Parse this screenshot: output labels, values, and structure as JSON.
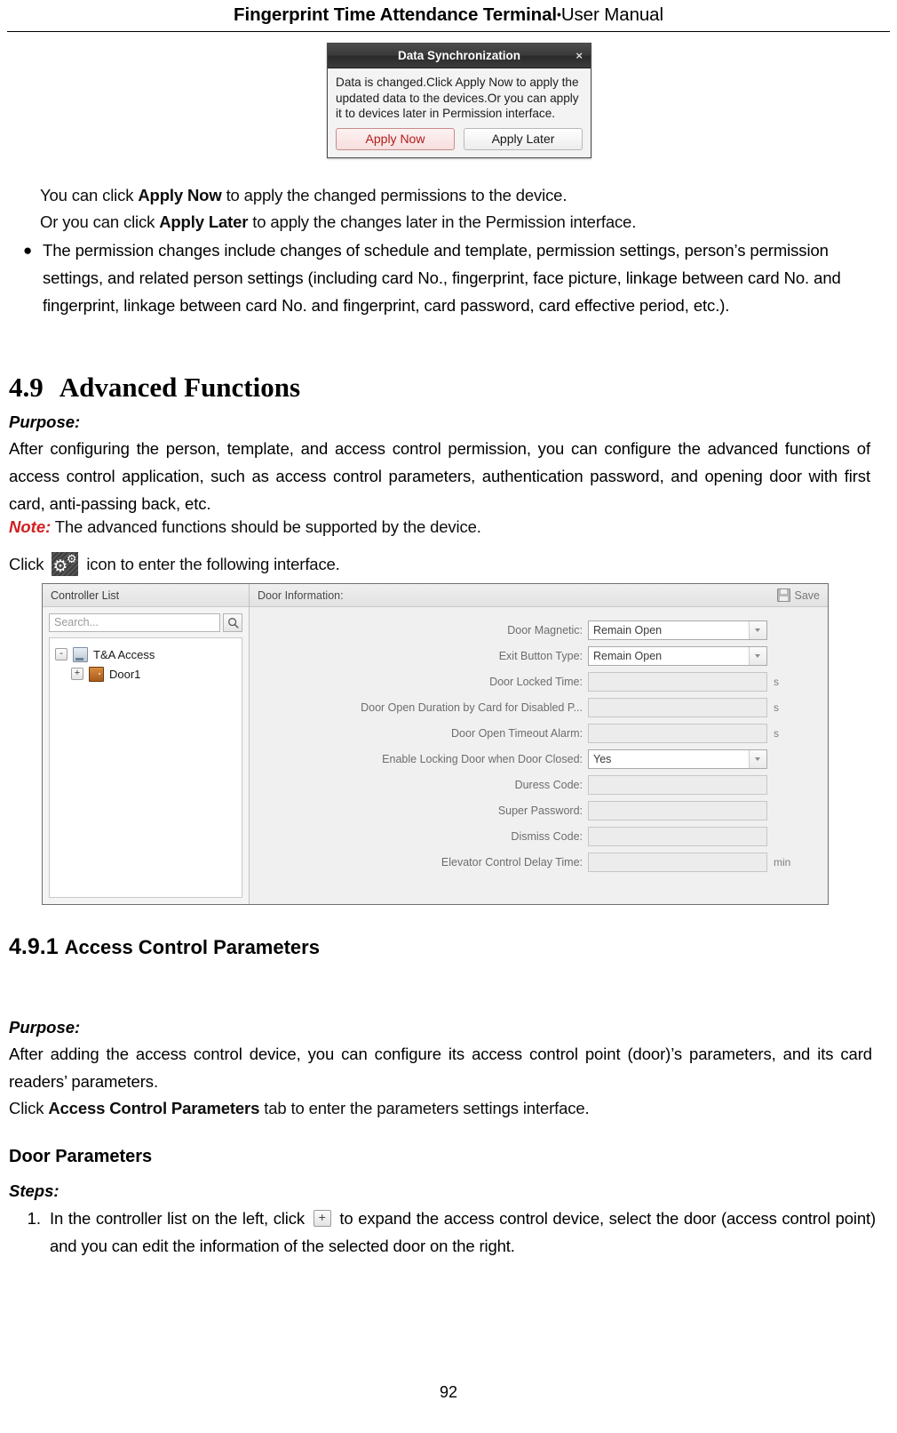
{
  "header": {
    "title_bold": "Fingerprint Time Attendance Terminal",
    "separator": "•",
    "title_normal": "User Manual"
  },
  "dialog": {
    "title": "Data Synchronization",
    "close_label": "×",
    "message": "Data is changed.Click Apply Now to apply the updated data to the devices.Or you can apply it to devices later in Permission interface.",
    "apply_now_label": "Apply Now",
    "apply_later_label": "Apply Later",
    "accent_color": "#b11b1b"
  },
  "body": {
    "line1_pre": "You can click ",
    "line1_bold": "Apply Now",
    "line1_post": " to apply the changed permissions to the device.",
    "line2_pre": "Or you can click ",
    "line2_bold": "Apply Later",
    "line2_post": " to apply the changes later in the Permission interface.",
    "bullet_symbol": "●",
    "bullet_text": "The permission changes include changes of schedule and template, permission settings, person’s permission settings, and related person settings (including card No., fingerprint, face picture, linkage between card No. and fingerprint, linkage between card No. and fingerprint, card password, card effective period, etc.)."
  },
  "section_49": {
    "number": "4.9",
    "title": "Advanced Functions",
    "purpose_label": "Purpose:",
    "purpose_text": "After configuring the person, template, and access control permission, you can configure the advanced functions of access control application, such as access control parameters, authentication password, and opening door with first card, anti-passing back, etc.",
    "note_label": "Note:",
    "note_text": "The advanced functions should be supported by the device.",
    "click_pre": "Click",
    "click_post": "icon to enter the following interface.",
    "note_color": "#d21f1f"
  },
  "app": {
    "left_panel": {
      "header": "Controller List",
      "search_placeholder": "Search...",
      "search_icon": "search-icon",
      "tree": [
        {
          "label": "T&A Access",
          "expander": "-",
          "icon": "device-icon",
          "level": 0
        },
        {
          "label": "Door1",
          "expander": "+",
          "icon": "door-icon",
          "level": 1
        }
      ]
    },
    "right_panel": {
      "header": "Door Information:",
      "save_label": "Save",
      "save_icon": "save-icon",
      "fields": [
        {
          "label": "Door Magnetic:",
          "type": "select",
          "value": "Remain Open",
          "unit": ""
        },
        {
          "label": "Exit Button Type:",
          "type": "select",
          "value": "Remain Open",
          "unit": ""
        },
        {
          "label": "Door Locked Time:",
          "type": "input",
          "value": "",
          "unit": "s"
        },
        {
          "label": "Door Open Duration by Card for Disabled P...",
          "type": "input",
          "value": "",
          "unit": "s"
        },
        {
          "label": "Door Open Timeout Alarm:",
          "type": "input",
          "value": "",
          "unit": "s"
        },
        {
          "label": "Enable Locking Door when Door Closed:",
          "type": "select",
          "value": "Yes",
          "unit": ""
        },
        {
          "label": "Duress Code:",
          "type": "input",
          "value": "",
          "unit": ""
        },
        {
          "label": "Super Password:",
          "type": "input",
          "value": "",
          "unit": ""
        },
        {
          "label": "Dismiss Code:",
          "type": "input",
          "value": "",
          "unit": ""
        },
        {
          "label": "Elevator Control Delay Time:",
          "type": "input",
          "value": "",
          "unit": "min"
        }
      ]
    }
  },
  "section_491": {
    "number": "4.9.1",
    "title": "Access Control Parameters",
    "purpose_label": "Purpose:",
    "purpose_text": "After adding the access control device, you can configure its access control point (door)’s parameters, and its card readers’ parameters.",
    "click_line_pre": "Click ",
    "click_line_bold": "Access Control Parameters",
    "click_line_post": " tab to enter the parameters settings interface.",
    "subheading": "Door Parameters",
    "steps_label": "Steps:",
    "step1_number": "1.",
    "step1_pre": "In the controller list on the left, click",
    "step1_post": "to expand the access control device, select the door (access control point) and you can edit the information of the selected door on the right."
  },
  "footer": {
    "page_number": "92"
  }
}
